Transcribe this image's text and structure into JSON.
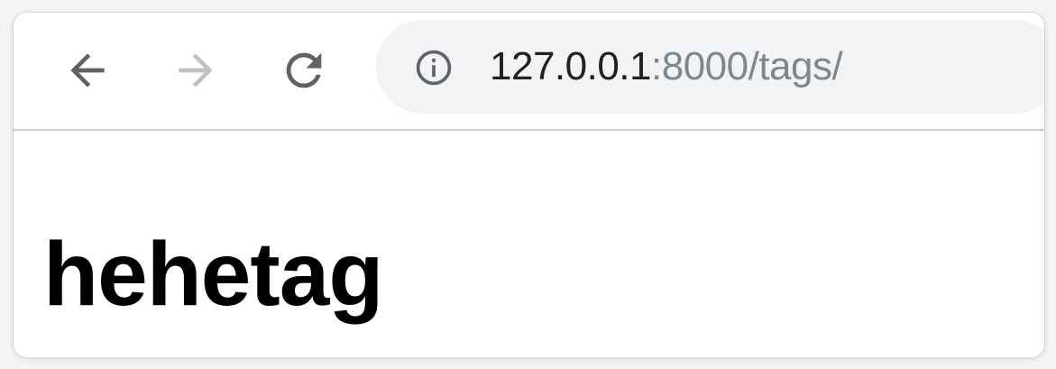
{
  "browser": {
    "nav": {
      "back_icon": "arrow-left-icon",
      "forward_icon": "arrow-right-icon",
      "reload_icon": "reload-icon",
      "active_color": "#5f6368",
      "disabled_color": "#bdc1c6"
    },
    "address_bar": {
      "info_icon": "info-icon",
      "url_host": "127.0.0.1",
      "url_rest": ":8000/tags/",
      "background": "#f1f3f4"
    }
  },
  "page": {
    "heading": "hehetag"
  }
}
